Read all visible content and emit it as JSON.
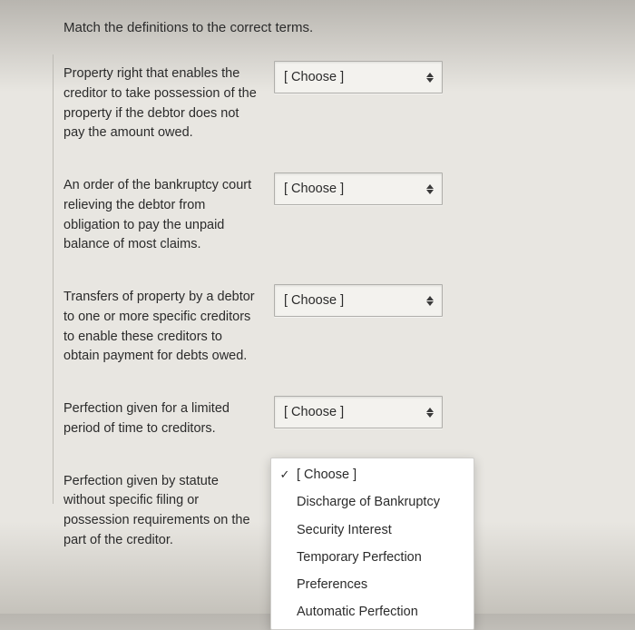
{
  "instruction": "Match the definitions to the correct terms.",
  "placeholder": "[ Choose ]",
  "questions": [
    {
      "definition": "Property right that enables the creditor to take possession of the property if the debtor does not pay the amount owed."
    },
    {
      "definition": "An order of the bankruptcy court relieving the debtor from obligation to pay the unpaid balance of most claims."
    },
    {
      "definition": "Transfers of property by a debtor to one or more specific creditors to enable these creditors to obtain payment for debts owed."
    },
    {
      "definition": "Perfection given for a limited period of time to creditors."
    },
    {
      "definition": "Perfection given by statute without specific filing or possession requirements on the part of the creditor."
    }
  ],
  "dropdown_options": [
    {
      "label": "[ Choose ]",
      "selected": true
    },
    {
      "label": "Discharge of Bankruptcy",
      "selected": false
    },
    {
      "label": "Security Interest",
      "selected": false
    },
    {
      "label": "Temporary Perfection",
      "selected": false
    },
    {
      "label": "Preferences",
      "selected": false
    },
    {
      "label": "Automatic Perfection",
      "selected": false
    }
  ]
}
